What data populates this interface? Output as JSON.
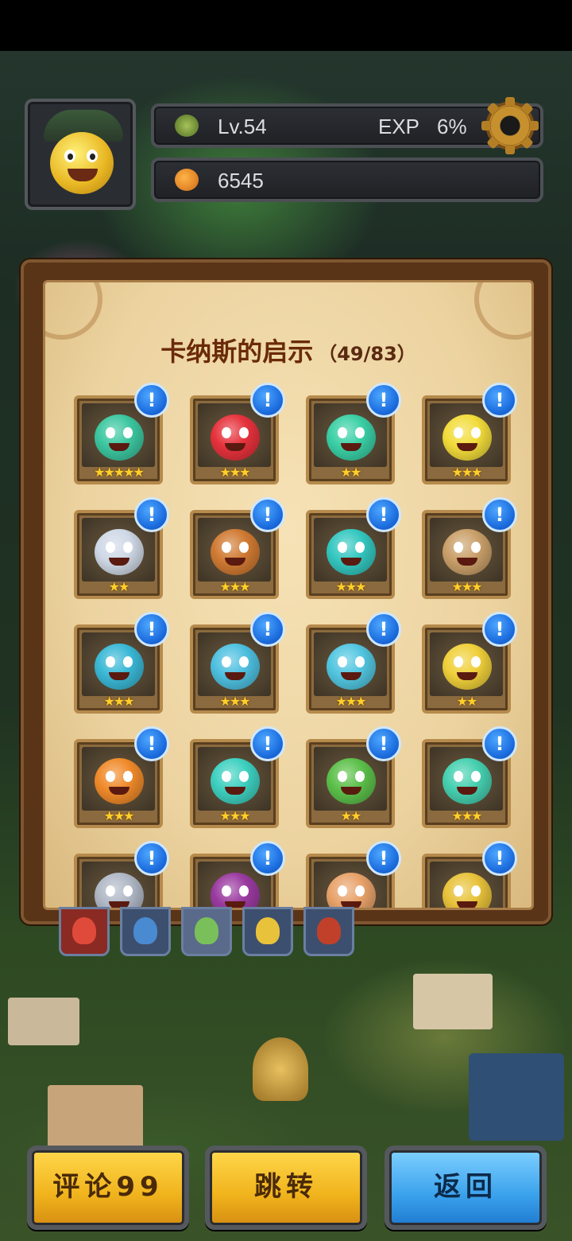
{
  "hud": {
    "level": "Lv.54",
    "exp_label": "EXP",
    "exp_value": "6%",
    "gold": "6545"
  },
  "panel": {
    "title": "卡纳斯的启示",
    "count": "（49/83）"
  },
  "cards": [
    {
      "stars": "★★★★★",
      "color": "#3cc7a0"
    },
    {
      "stars": "★★★",
      "color": "#e6323c"
    },
    {
      "stars": "★★",
      "color": "#3ad0a6"
    },
    {
      "stars": "★★★",
      "color": "#f2dc3a"
    },
    {
      "stars": "★★",
      "color": "#cfd8e6"
    },
    {
      "stars": "★★★",
      "color": "#d07a32"
    },
    {
      "stars": "★★★",
      "color": "#34c7c0"
    },
    {
      "stars": "★★★",
      "color": "#caa06a"
    },
    {
      "stars": "★★★",
      "color": "#3ab8d6"
    },
    {
      "stars": "★★★",
      "color": "#4ec0e0"
    },
    {
      "stars": "★★★",
      "color": "#52c6e0"
    },
    {
      "stars": "★★",
      "color": "#f0d03a"
    },
    {
      "stars": "★★★",
      "color": "#f08a2a"
    },
    {
      "stars": "★★★",
      "color": "#3ed0c0"
    },
    {
      "stars": "★★",
      "color": "#5cc04a"
    },
    {
      "stars": "★★★",
      "color": "#46d0b0"
    },
    {
      "stars": "",
      "color": "#b0b8c6"
    },
    {
      "stars": "",
      "color": "#9a3aa0"
    },
    {
      "stars": "",
      "color": "#e8a26a"
    },
    {
      "stars": "",
      "color": "#e8c23a"
    }
  ],
  "badge_symbol": "!",
  "tabs": [
    {
      "icon": "mixed-monsters-tab-icon",
      "color": "#e04a3a"
    },
    {
      "icon": "blue-monster-tab-icon",
      "color": "#4a8ad0"
    },
    {
      "icon": "green-monster-tab-icon",
      "color": "#7ac05a"
    },
    {
      "icon": "yellow-monster-tab-icon",
      "color": "#e8c23a"
    },
    {
      "icon": "red-monster-tab-icon",
      "color": "#c0402a"
    }
  ],
  "buttons": {
    "comment": "评论99",
    "jump": "跳转",
    "back": "返回"
  },
  "colors": {
    "gold_button": "#f0b31c",
    "blue_button": "#3aa2ec",
    "badge_blue": "#1e6fe0",
    "star_gold": "#ffcf2a"
  }
}
